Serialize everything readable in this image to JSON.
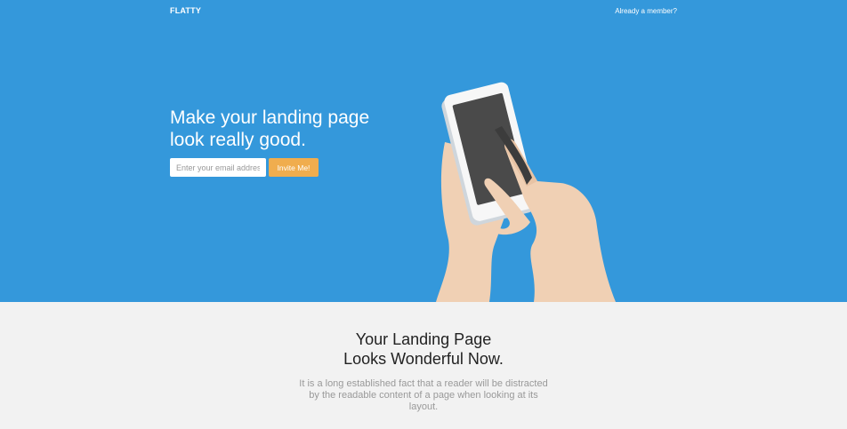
{
  "nav": {
    "brand": "FLATTY",
    "member_link": "Already a member?"
  },
  "hero": {
    "headline_line1": "Make your landing page",
    "headline_line2": "look really good.",
    "email_placeholder": "Enter your email address",
    "invite_label": "Invite Me!",
    "illustration_icon": "hand-holding-phone-icon"
  },
  "features": {
    "title_line1": "Your Landing Page",
    "title_line2": "Looks Wonderful Now.",
    "text": "It is a long established fact that a reader will be distracted by the readable content of a page when looking at its layout."
  },
  "colors": {
    "hero_bg": "#3498db",
    "accent": "#f0ad4e",
    "section_bg": "#f2f2f2"
  }
}
